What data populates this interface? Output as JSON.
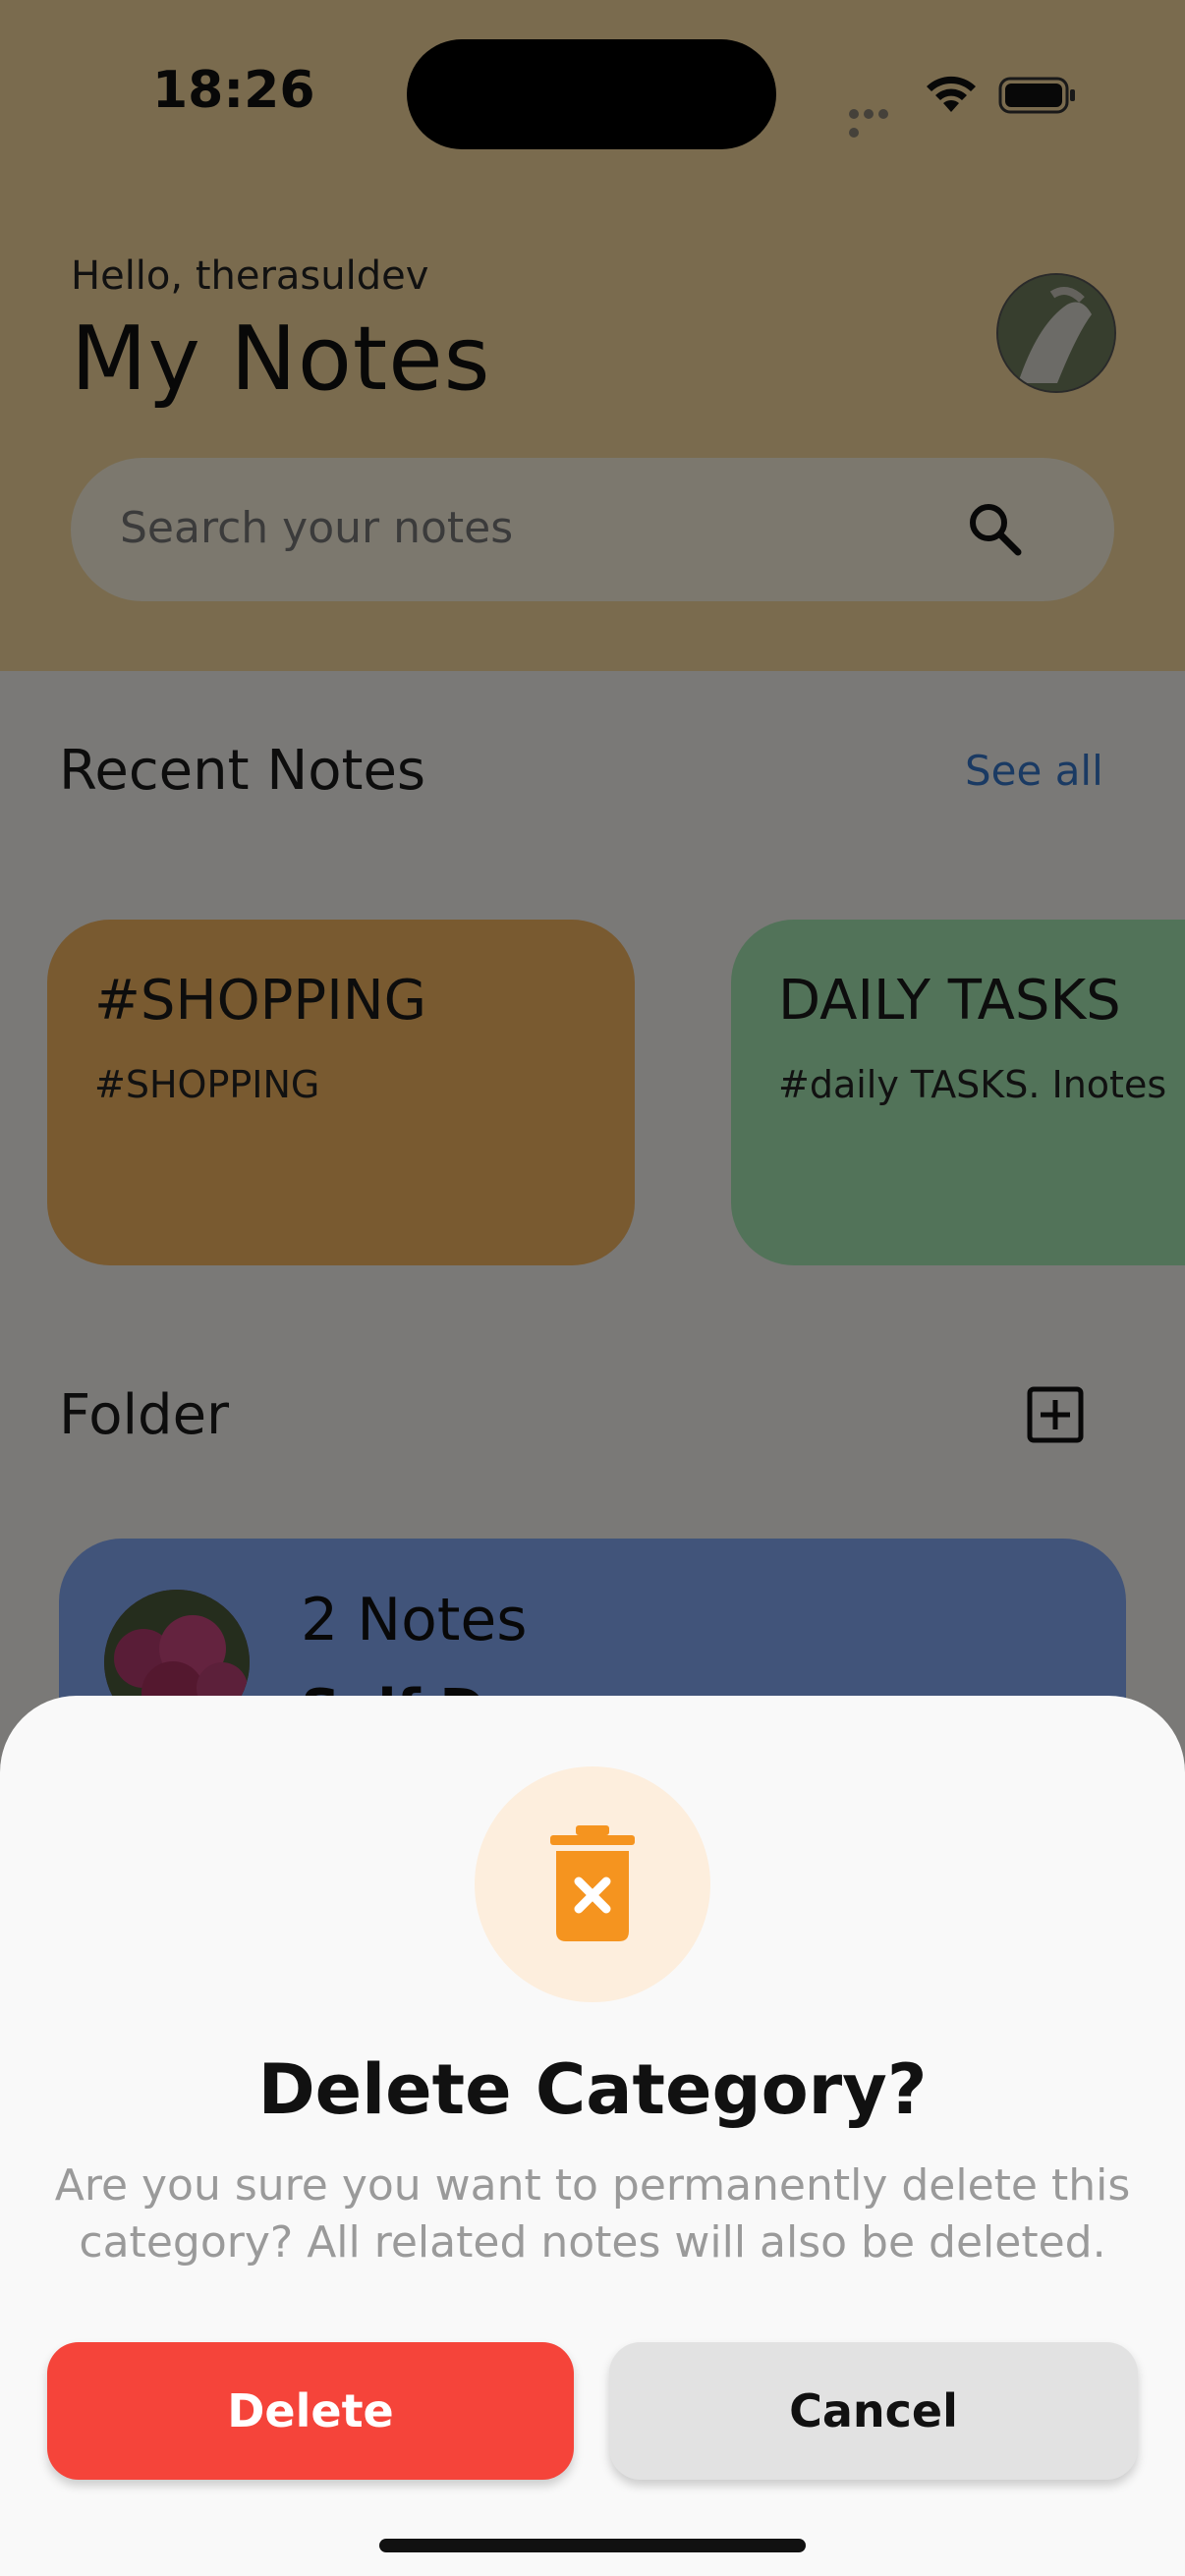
{
  "status_bar": {
    "time": "18:26"
  },
  "header": {
    "greeting": "Hello, therasuldev",
    "title": "My Notes",
    "search_placeholder": "Search your notes"
  },
  "recent": {
    "heading": "Recent Notes",
    "see_all": "See all",
    "cards": [
      {
        "title": "#SHOPPING",
        "subtitle": "#SHOPPING",
        "color": "#f2b461"
      },
      {
        "title": "DAILY TASKS",
        "subtitle": "#daily TASKS. Inotes",
        "color": "#a4e6b2"
      }
    ]
  },
  "folder": {
    "heading": "Folder",
    "items": [
      {
        "count": "2 Notes",
        "name": "Self Dev",
        "color": "#83a8f5"
      }
    ]
  },
  "dialog": {
    "title": "Delete Category?",
    "message": "Are you sure you want to permanently delete this category? All related notes will also be deleted.",
    "delete_label": "Delete",
    "cancel_label": "Cancel",
    "icon": "trash-x-icon",
    "accent_color": "#f5941f",
    "delete_color": "#f5443a"
  }
}
